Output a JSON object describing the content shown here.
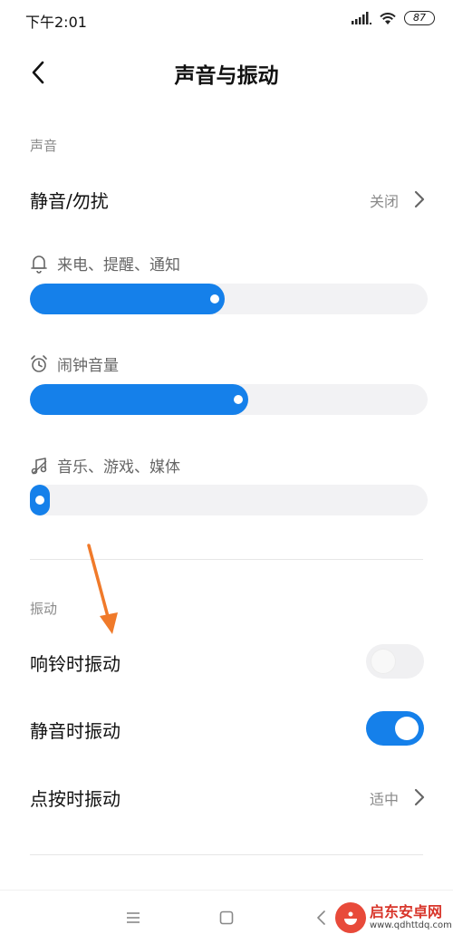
{
  "status_bar": {
    "time": "下午2:01",
    "battery": "87",
    "icons": [
      "signal-icon",
      "wifi-icon",
      "battery-icon"
    ]
  },
  "header": {
    "title": "声音与振动",
    "back_icon": "back-arrow-icon"
  },
  "sound_section": {
    "label": "声音",
    "silent": {
      "label": "静音/勿扰",
      "value": "关闭"
    },
    "volumes": [
      {
        "label": "来电、提醒、通知",
        "icon": "bell-icon",
        "level": 0.49
      },
      {
        "label": "闹钟音量",
        "icon": "alarm-clock-icon",
        "level": 0.55
      },
      {
        "label": "音乐、游戏、媒体",
        "icon": "music-note-icon",
        "level": 0.0
      }
    ]
  },
  "vibration_section": {
    "label": "振动",
    "items": [
      {
        "label": "响铃时振动",
        "toggle": false
      },
      {
        "label": "静音时振动",
        "toggle": true
      },
      {
        "label": "点按时振动",
        "value": "适中"
      }
    ]
  },
  "nav_bar": {
    "buttons": [
      "menu-icon",
      "home-icon",
      "back-icon"
    ]
  },
  "watermark": {
    "name": "启东安卓网",
    "url": "www.qdhttdq.com"
  },
  "colors": {
    "accent": "#1580ea",
    "track": "#f2f2f4",
    "secondary_text": "#8a8a8a",
    "annotation_arrow": "#f07a2a"
  }
}
